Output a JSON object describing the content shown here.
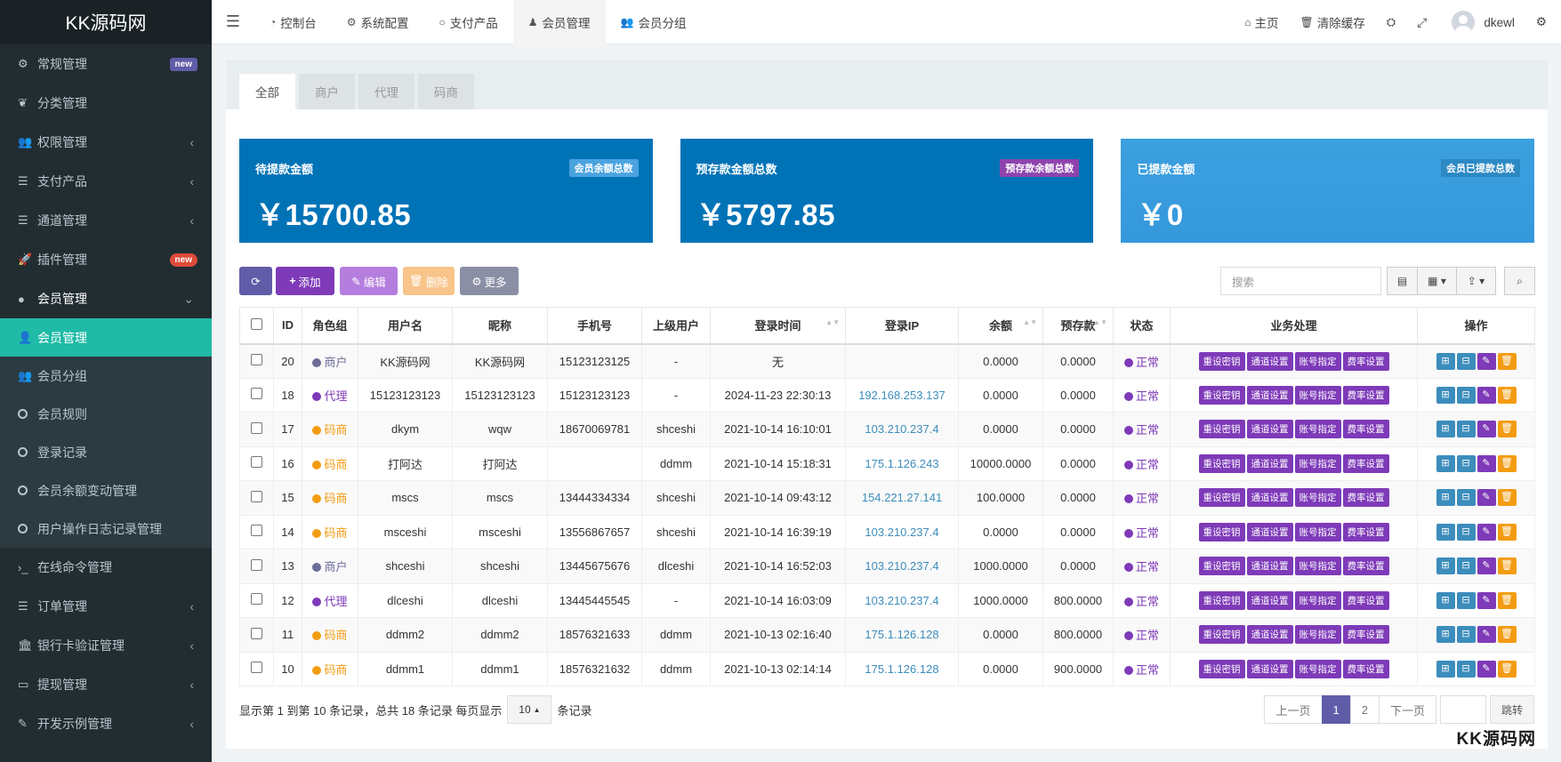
{
  "app": {
    "logo": "KK源码网"
  },
  "sidebar": {
    "items": [
      {
        "label": "常规管理",
        "icon": "cogs-icon",
        "glyph": "⚙",
        "badge": "new",
        "badge_color": "purple"
      },
      {
        "label": "分类管理",
        "icon": "leaf-icon",
        "glyph": "❦"
      },
      {
        "label": "权限管理",
        "icon": "group-icon",
        "glyph": "👥",
        "arrow": "‹"
      },
      {
        "label": "支付产品",
        "icon": "list-icon",
        "glyph": "☰",
        "arrow": "‹"
      },
      {
        "label": "通道管理",
        "icon": "list-icon",
        "glyph": "☰",
        "arrow": "‹"
      },
      {
        "label": "插件管理",
        "icon": "rocket-icon",
        "glyph": "🚀",
        "badge": "new",
        "badge_color": "red"
      },
      {
        "label": "会员管理",
        "icon": "user-circle-icon",
        "glyph": "●",
        "arrow": "⌄"
      }
    ],
    "sub_items": [
      {
        "label": "会员管理",
        "icon": "user-icon",
        "glyph": "👤",
        "active": true
      },
      {
        "label": "会员分组",
        "icon": "users-icon",
        "glyph": "👥"
      },
      {
        "label": "会员规则",
        "icon": "circle-icon"
      },
      {
        "label": "登录记录",
        "icon": "circle-icon"
      },
      {
        "label": "会员余额变动管理",
        "icon": "circle-icon"
      },
      {
        "label": "用户操作日志记录管理",
        "icon": "circle-icon"
      }
    ],
    "items_after": [
      {
        "label": "在线命令管理",
        "icon": "terminal-icon",
        "glyph": "›_"
      },
      {
        "label": "订单管理",
        "icon": "list-icon",
        "glyph": "☰",
        "arrow": "‹"
      },
      {
        "label": "银行卡验证管理",
        "icon": "bank-icon",
        "glyph": "🏛",
        "arrow": "‹"
      },
      {
        "label": "提现管理",
        "icon": "visa-icon",
        "glyph": "▭",
        "arrow": "‹"
      },
      {
        "label": "开发示例管理",
        "icon": "magic-icon",
        "glyph": "✎",
        "arrow": "‹"
      }
    ]
  },
  "navbar": {
    "tabs": [
      {
        "label": "控制台",
        "icon": "dashboard-icon",
        "glyph": "◔"
      },
      {
        "label": "系统配置",
        "icon": "gear-icon",
        "glyph": "⚙"
      },
      {
        "label": "支付产品",
        "icon": "circle-icon",
        "glyph": "○"
      },
      {
        "label": "会员管理",
        "icon": "user-icon",
        "glyph": "♟",
        "active": true
      },
      {
        "label": "会员分组",
        "icon": "users-icon",
        "glyph": "👥"
      }
    ],
    "home": "主页",
    "clear_cache": "清除缓存",
    "username": "dkewl"
  },
  "panel": {
    "tabs": [
      "全部",
      "商户",
      "代理",
      "码商"
    ],
    "stats": [
      {
        "title": "待提款金额",
        "tag": "会员余额总数",
        "value": "￥15700.85"
      },
      {
        "title": "预存款金额总数",
        "tag": "预存款余额总数",
        "value": "￥5797.85"
      },
      {
        "title": "已提款金额",
        "tag": "会员已提款总数",
        "value": "￥0"
      }
    ],
    "toolbar": {
      "add": "添加",
      "edit": "编辑",
      "delete": "删除",
      "more": "更多",
      "search_placeholder": "搜索"
    }
  },
  "table": {
    "headers": [
      "ID",
      "角色组",
      "用户名",
      "昵称",
      "手机号",
      "上级用户",
      "登录时间",
      "登录IP",
      "余额",
      "预存款",
      "状态",
      "业务处理",
      "操作"
    ],
    "actions": [
      "重设密钥",
      "通道设置",
      "账号指定",
      "费率设置"
    ],
    "rows": [
      {
        "id": "20",
        "role": "商户",
        "role_type": "merchant",
        "username": "KK源码网",
        "nickname": "KK源码网",
        "phone": "15123123125",
        "parent": "-",
        "login_time": "无",
        "ip": "",
        "balance": "0.0000",
        "deposit": "0.0000",
        "status": "正常"
      },
      {
        "id": "18",
        "role": "代理",
        "role_type": "agent",
        "username": "15123123123",
        "nickname": "15123123123",
        "phone": "15123123123",
        "parent": "-",
        "login_time": "2024-11-23 22:30:13",
        "ip": "192.168.253.137",
        "balance": "0.0000",
        "deposit": "0.0000",
        "status": "正常"
      },
      {
        "id": "17",
        "role": "码商",
        "role_type": "code",
        "username": "dkym",
        "nickname": "wqw",
        "phone": "18670069781",
        "parent": "shceshi",
        "login_time": "2021-10-14 16:10:01",
        "ip": "103.210.237.4",
        "balance": "0.0000",
        "deposit": "0.0000",
        "status": "正常"
      },
      {
        "id": "16",
        "role": "码商",
        "role_type": "code",
        "username": "打阿达",
        "nickname": "打阿达",
        "phone": "",
        "parent": "ddmm",
        "login_time": "2021-10-14 15:18:31",
        "ip": "175.1.126.243",
        "balance": "10000.0000",
        "deposit": "0.0000",
        "status": "正常"
      },
      {
        "id": "15",
        "role": "码商",
        "role_type": "code",
        "username": "mscs",
        "nickname": "mscs",
        "phone": "13444334334",
        "parent": "shceshi",
        "login_time": "2021-10-14 09:43:12",
        "ip": "154.221.27.141",
        "balance": "100.0000",
        "deposit": "0.0000",
        "status": "正常"
      },
      {
        "id": "14",
        "role": "码商",
        "role_type": "code",
        "username": "msceshi",
        "nickname": "msceshi",
        "phone": "13556867657",
        "parent": "shceshi",
        "login_time": "2021-10-14 16:39:19",
        "ip": "103.210.237.4",
        "balance": "0.0000",
        "deposit": "0.0000",
        "status": "正常"
      },
      {
        "id": "13",
        "role": "商户",
        "role_type": "merchant",
        "username": "shceshi",
        "nickname": "shceshi",
        "phone": "13445675676",
        "parent": "dlceshi",
        "login_time": "2021-10-14 16:52:03",
        "ip": "103.210.237.4",
        "balance": "1000.0000",
        "deposit": "0.0000",
        "status": "正常"
      },
      {
        "id": "12",
        "role": "代理",
        "role_type": "agent",
        "username": "dlceshi",
        "nickname": "dlceshi",
        "phone": "13445445545",
        "parent": "-",
        "login_time": "2021-10-14 16:03:09",
        "ip": "103.210.237.4",
        "balance": "1000.0000",
        "deposit": "800.0000",
        "status": "正常"
      },
      {
        "id": "11",
        "role": "码商",
        "role_type": "code",
        "username": "ddmm2",
        "nickname": "ddmm2",
        "phone": "18576321633",
        "parent": "ddmm",
        "login_time": "2021-10-13 02:16:40",
        "ip": "175.1.126.128",
        "balance": "0.0000",
        "deposit": "800.0000",
        "status": "正常"
      },
      {
        "id": "10",
        "role": "码商",
        "role_type": "code",
        "username": "ddmm1",
        "nickname": "ddmm1",
        "phone": "18576321632",
        "parent": "ddmm",
        "login_time": "2021-10-13 02:14:14",
        "ip": "175.1.126.128",
        "balance": "0.0000",
        "deposit": "900.0000",
        "status": "正常"
      }
    ]
  },
  "pagination": {
    "info_prefix": "显示第 1 到第 10 条记录，总共 18 条记录 每页显示",
    "page_size": "10",
    "info_suffix": "条记录",
    "prev": "上一页",
    "pages": [
      "1",
      "2"
    ],
    "current": "1",
    "next": "下一页",
    "jump": "跳转"
  },
  "watermark": "KK源码网",
  "colors": {
    "sidebar": "#222d32",
    "active": "#1fbba6",
    "purple": "#7e3ab8",
    "blue": "#0073b7",
    "orange": "#f39c12"
  }
}
